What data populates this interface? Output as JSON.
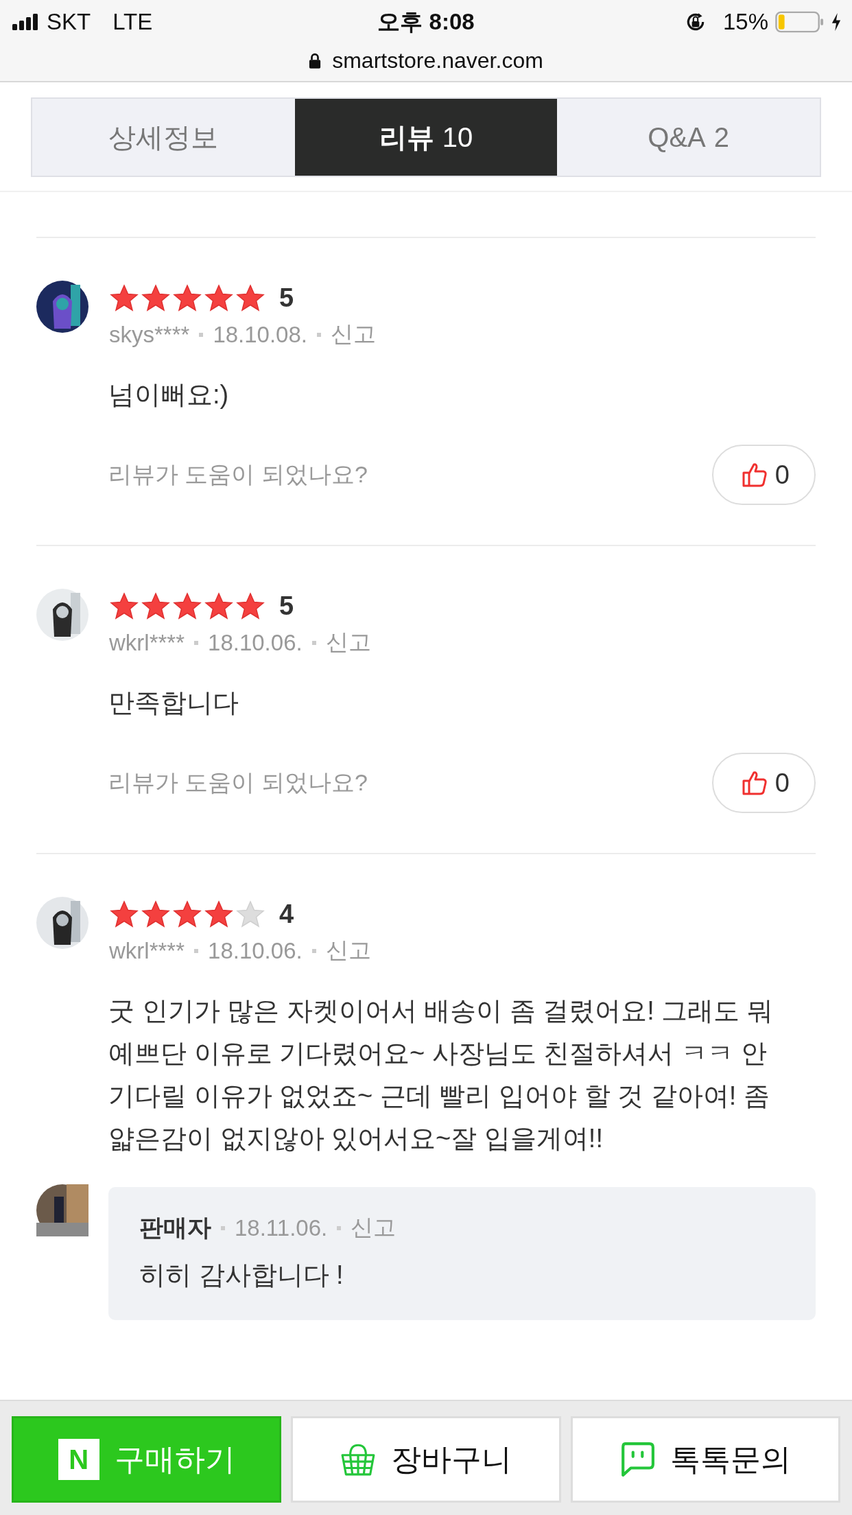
{
  "status_bar": {
    "carrier": "SKT",
    "network": "LTE",
    "time": "오후 8:08",
    "battery": "15%"
  },
  "address_bar": {
    "url": "smartstore.naver.com"
  },
  "tabs": [
    {
      "label": "상세정보",
      "selected": false
    },
    {
      "label": "리뷰",
      "count": "10",
      "selected": true
    },
    {
      "label": "Q&A",
      "count": "2",
      "selected": false
    }
  ],
  "reviews": [
    {
      "stars": 5,
      "score": "5",
      "user": "skys****",
      "date": "18.10.08.",
      "report": "신고",
      "text": "넘이뻐요:)",
      "helpful_prompt": "리뷰가 도움이 되었나요?",
      "likes": "0"
    },
    {
      "stars": 5,
      "score": "5",
      "user": "wkrl****",
      "date": "18.10.06.",
      "report": "신고",
      "text": "만족합니다",
      "helpful_prompt": "리뷰가 도움이 되었나요?",
      "likes": "0"
    },
    {
      "stars": 4,
      "score": "4",
      "user": "wkrl****",
      "date": "18.10.06.",
      "report": "신고",
      "text": "굿 인기가 많은 자켓이어서 배송이 좀 걸렸어요! 그래도 뭐 예쁘단 이유로 기다렸어요~ 사장님도 친절하셔서 ㅋㅋ 안 기다릴 이유가 없었죠~ 근데 빨리 입어야 할 것 같아여! 좀 얇은감이 없지않아 있어서요~잘 입을게여!!",
      "reply": {
        "author": "판매자",
        "date": "18.11.06.",
        "report": "신고",
        "text": "히히 감사합니다 !"
      }
    }
  ],
  "bottom_bar": [
    {
      "kind": "buy",
      "logo": "N",
      "label": "구매하기"
    },
    {
      "kind": "cart",
      "label": "장바구니"
    },
    {
      "kind": "talk",
      "label": "톡톡문의"
    }
  ]
}
